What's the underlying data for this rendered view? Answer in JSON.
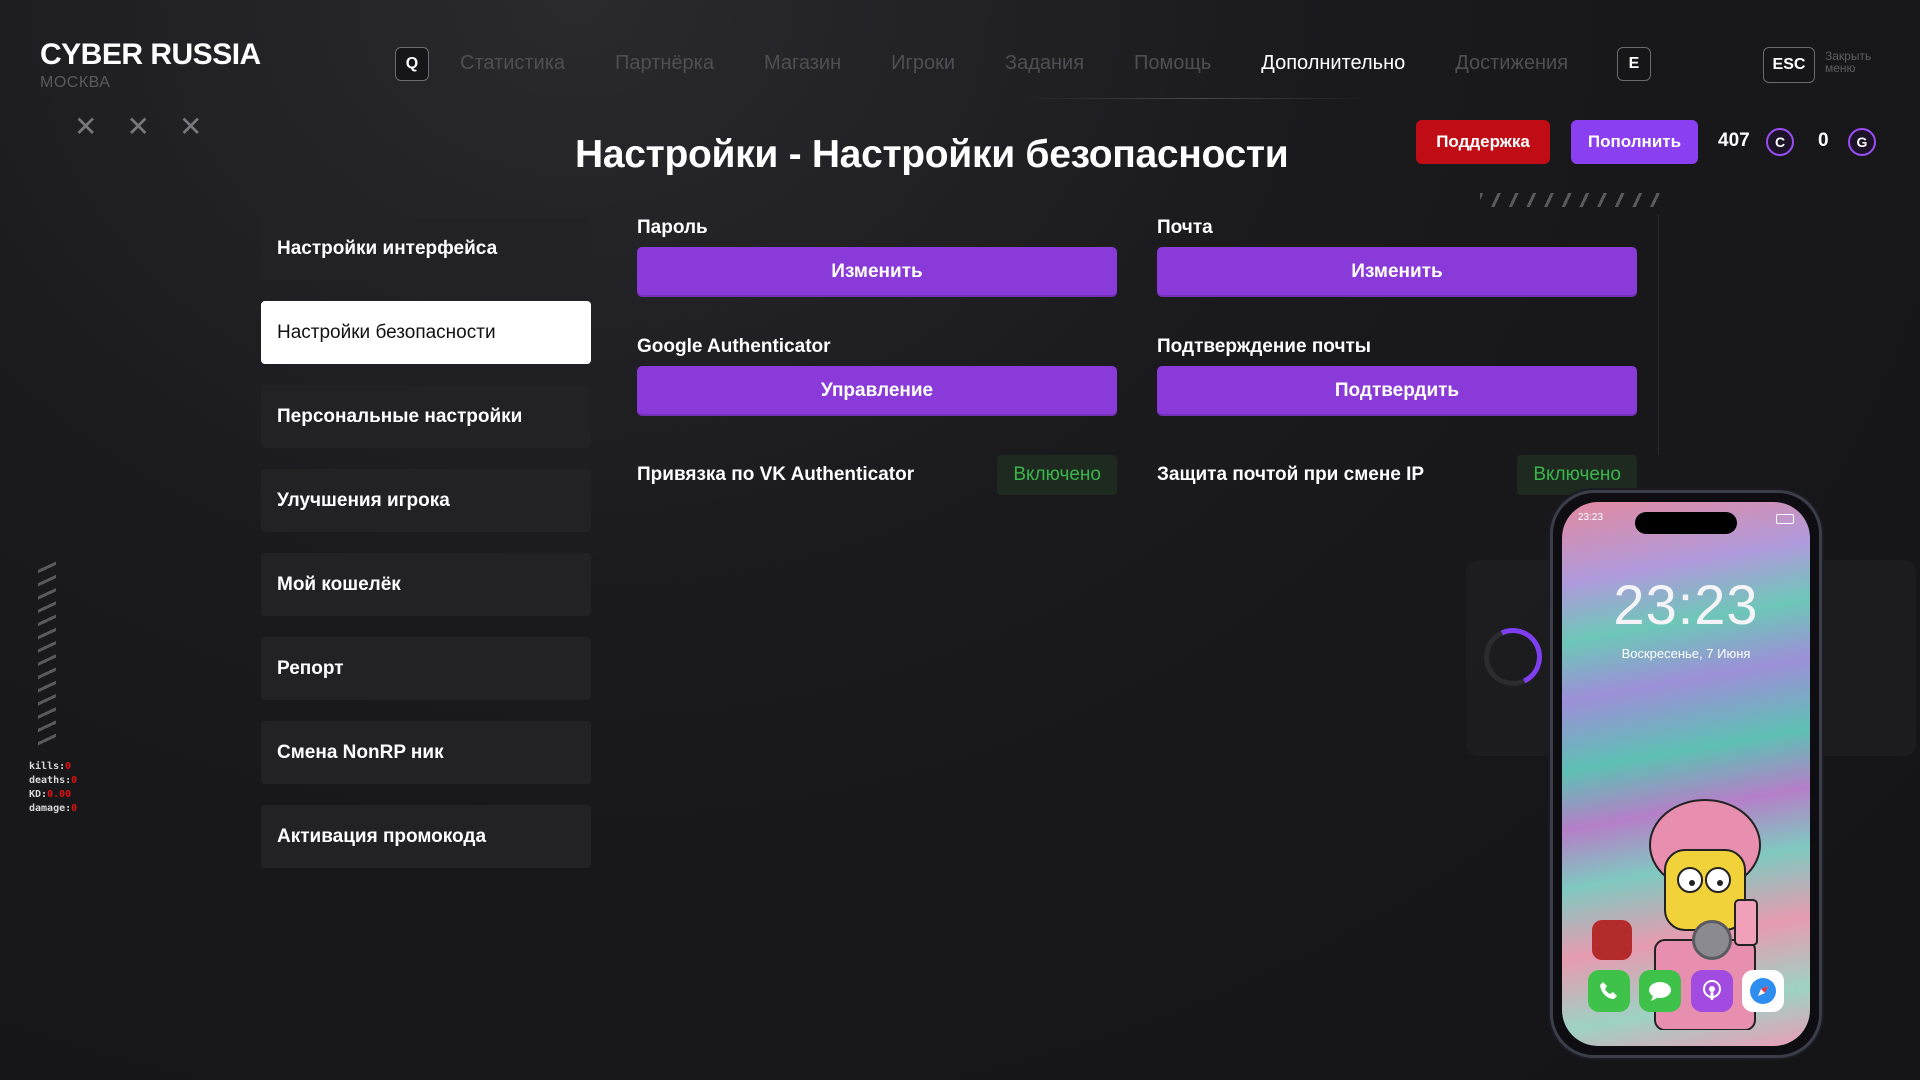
{
  "brand": {
    "title": "CYBER RUSSIA",
    "city": "МОСКВА"
  },
  "keys": {
    "left": "Q",
    "right": "E",
    "esc": "ESC",
    "close_note": "Закрыть меню"
  },
  "nav": [
    "Статистика",
    "Партнёрка",
    "Магазин",
    "Игроки",
    "Задания",
    "Помощь",
    "Дополнительно",
    "Достижения"
  ],
  "nav_active": "Дополнительно",
  "page_title": "Настройки - Настройки безопасности",
  "header": {
    "support_label": "Поддержка",
    "topup_label": "Пополнить",
    "coins_c": "407",
    "coin_c_symbol": "C",
    "coins_g": "0",
    "coin_g_symbol": "G"
  },
  "sidebar": {
    "items": [
      {
        "label": "Настройки интерфейса",
        "active": false
      },
      {
        "label": "Настройки безопасности",
        "active": true
      },
      {
        "label": "Персональные настройки",
        "active": false
      },
      {
        "label": "Улучшения игрока",
        "active": false
      },
      {
        "label": "Мой кошелёк",
        "active": false
      },
      {
        "label": "Репорт",
        "active": false
      },
      {
        "label": "Смена NonRP ник",
        "active": false
      },
      {
        "label": "Активация промокода",
        "active": false
      }
    ]
  },
  "security": {
    "password": {
      "label": "Пароль",
      "button": "Изменить"
    },
    "email": {
      "label": "Почта",
      "button": "Изменить"
    },
    "google_auth": {
      "label": "Google Authenticator",
      "button": "Управление"
    },
    "email_confirm": {
      "label": "Подтверждение почты",
      "button": "Подтвердить"
    },
    "vk_auth": {
      "label": "Привязка по VK Authenticator",
      "status": "Включено"
    },
    "ip_protect": {
      "label": "Защита почтой при смене IP",
      "status": "Включено"
    }
  },
  "stats": [
    {
      "key": "kills:",
      "value": "0"
    },
    {
      "key": "deaths:",
      "value": "0"
    },
    {
      "key": "KD:",
      "value": "0.00"
    },
    {
      "key": "damage:",
      "value": "0"
    }
  ],
  "phone": {
    "status_time": "23:23",
    "clock": "23:23",
    "date": "Воскресенье, 7 Июня"
  },
  "colors": {
    "accent": "#8a3ad8",
    "support": "#c00d15",
    "enabled": "#3ab54a"
  }
}
